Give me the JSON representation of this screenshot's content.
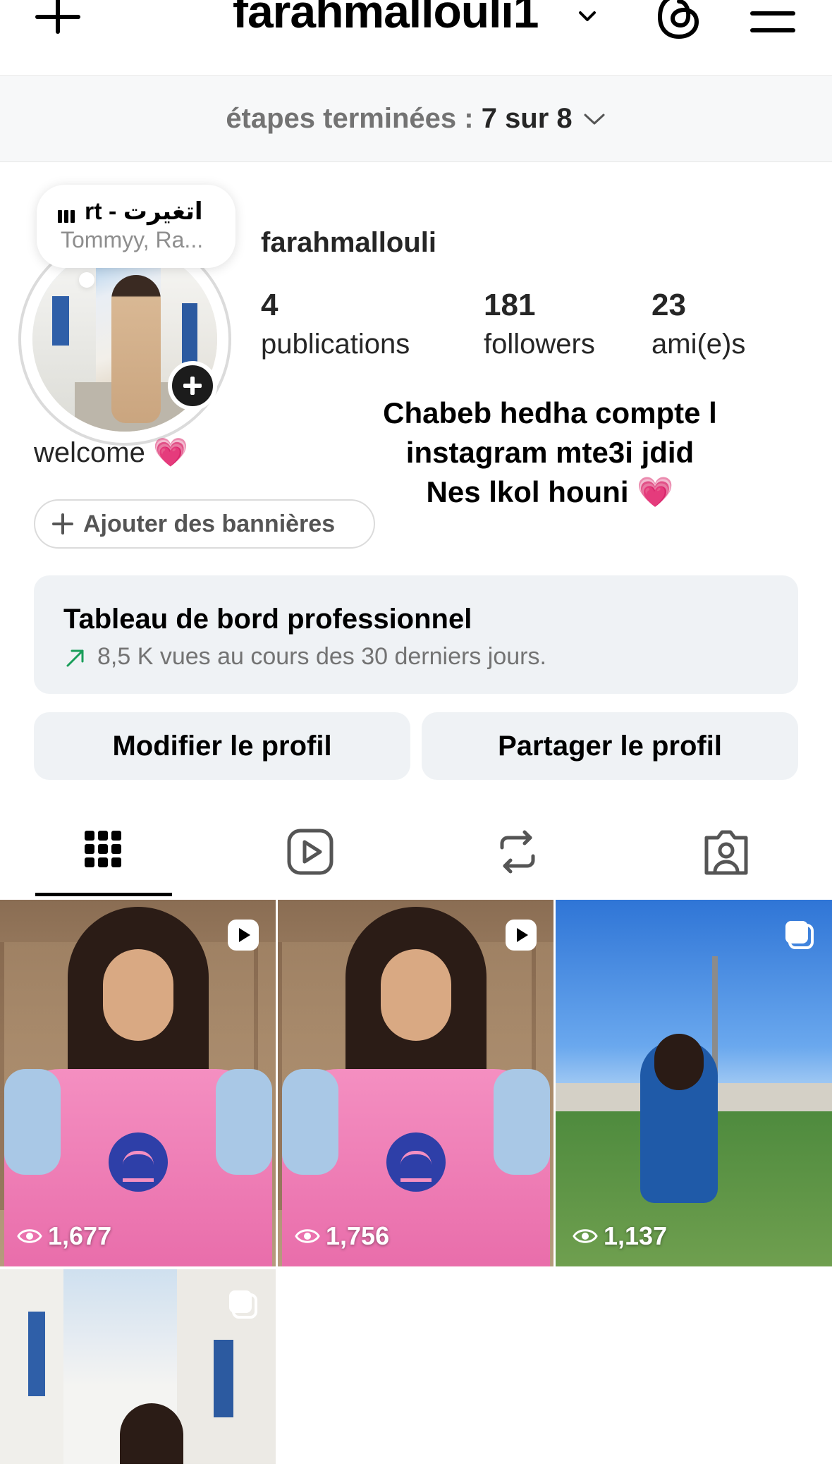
{
  "header": {
    "username": "farahmallouli1"
  },
  "steps": {
    "label": "étapes terminées : ",
    "value": "7 sur 8"
  },
  "music": {
    "title": "rt - اتغيرت",
    "artist": "Tommyy, Ra..."
  },
  "profile": {
    "name": "farahmallouli",
    "stats": [
      {
        "value": "4",
        "label": "publications"
      },
      {
        "value": "181",
        "label": "followers"
      },
      {
        "value": "23",
        "label": "ami(e)s"
      }
    ],
    "bio_left": "welcome 💗",
    "bio_right_lines": [
      "Chabeb hedha compte l",
      "instagram mte3i jdid",
      "Nes lkol houni 💗"
    ],
    "banner_button": "Ajouter des bannières"
  },
  "dashboard": {
    "title": "Tableau de bord professionnel",
    "subtitle": "8,5 K vues au cours des 30 derniers jours."
  },
  "actions": {
    "edit": "Modifier le profil",
    "share": "Partager le profil"
  },
  "tabs": [
    "grid-icon",
    "reels-icon",
    "reposts-icon",
    "tagged-icon"
  ],
  "posts": [
    {
      "views": "1,677",
      "type": "reel"
    },
    {
      "views": "1,756",
      "type": "reel"
    },
    {
      "views": "1,137",
      "type": "carousel"
    },
    {
      "views": "",
      "type": "carousel"
    }
  ],
  "colors": {
    "accent_green": "#1a9e5a",
    "button_bg": "#eff2f5"
  }
}
